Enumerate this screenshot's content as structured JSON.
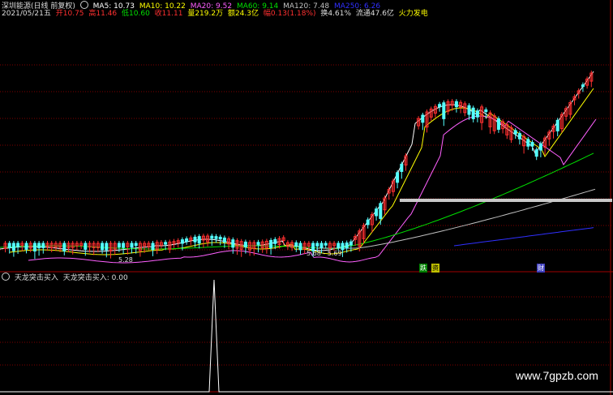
{
  "title": "深圳能源(日线 前复权)",
  "ma_line": {
    "ma5": "MA5: 10.73",
    "ma10": "MA10: 10.22",
    "ma20": "MA20: 9.52",
    "ma60": "MA60: 9.14",
    "ma120": "MA120: 7.48",
    "ma250": "MA250: 6.26"
  },
  "info_line": {
    "date": "2021/05/21五",
    "open": "开10.75",
    "high": "高11.46",
    "low": "低10.60",
    "close": "收11.11",
    "volume": "量219.2万",
    "amount": "额24.3亿",
    "change": "幅0.13(1.18%)",
    "turnover": "换4.61%",
    "float": "流通47.6亿",
    "indicator": "火力发电"
  },
  "annotations": {
    "low_price": "5.28",
    "range_label": "5.68 - 5.69",
    "tag_1": "跌",
    "tag_2": "资",
    "tag_3": "财"
  },
  "sub_panel": {
    "indicator_name": "天龙突击买入",
    "indicator_value": "天龙突击买入: 0.00"
  },
  "watermark": "www.7gpzb.com",
  "colors": {
    "up": "#ff3030",
    "down": "#54ffff",
    "ma5": "#ffffff",
    "ma10": "#ffff00",
    "ma20": "#ff60ff",
    "ma60": "#00e000",
    "ma120": "#c0c0c0",
    "ma250": "#3030ff",
    "grid": "#800000"
  }
}
